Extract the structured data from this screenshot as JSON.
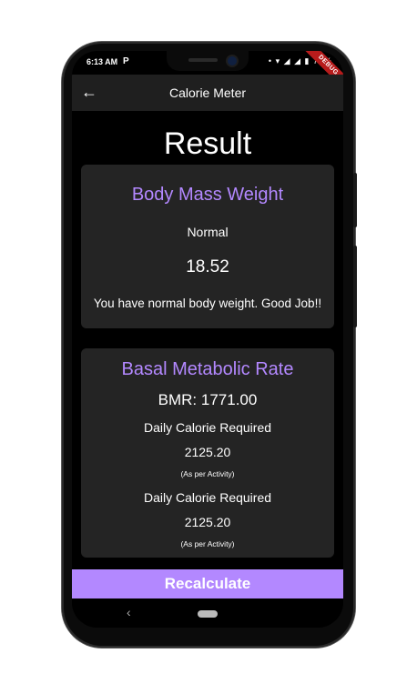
{
  "status_bar": {
    "time": "6:13 AM",
    "pin_icon": "P",
    "battery": "78%",
    "debug_banner": "DEBUG"
  },
  "appbar": {
    "back_icon": "←",
    "title": "Calorie Meter"
  },
  "result": {
    "title": "Result"
  },
  "bmi_card": {
    "title": "Body Mass Weight",
    "category": "Normal",
    "value": "18.52",
    "message": "You have normal body weight. Good Job!!"
  },
  "bmr_card": {
    "title": "Basal Metabolic Rate",
    "bmr": "BMR: 1771.00",
    "entries": [
      {
        "label": "Daily Calorie Required",
        "value": "2125.20",
        "note": "(As per Activity)"
      },
      {
        "label": "Daily Calorie Required",
        "value": "2125.20",
        "note": "(As per Activity)"
      }
    ]
  },
  "actions": {
    "recalculate_label": "Recalculate"
  },
  "nav": {
    "back_glyph": "‹"
  },
  "colors": {
    "accent": "#b388ff",
    "card_bg": "#242424",
    "appbar_bg": "#1f1f1f"
  }
}
